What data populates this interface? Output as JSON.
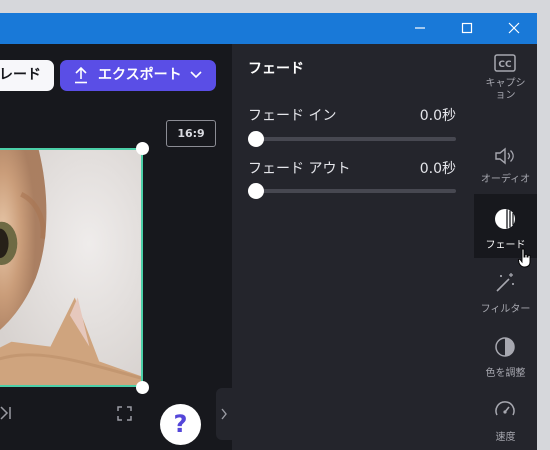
{
  "window": {
    "controls": {
      "minimize": "minimize-icon",
      "maximize": "maximize-icon",
      "close": "close-icon"
    },
    "accent": "#1979d8"
  },
  "toolbar": {
    "upgrade_label": "レード",
    "export_label": "エクスポート",
    "export_color": "#5a4ee6"
  },
  "canvas": {
    "aspect_ratio": "16:9",
    "frame_color": "#4ccfa8"
  },
  "help": {
    "label": "?"
  },
  "fade_panel": {
    "title": "フェード",
    "fade_in": {
      "label": "フェード イン",
      "value": "0.0秒",
      "level": 0
    },
    "fade_out": {
      "label": "フェード アウト",
      "value": "0.0秒",
      "level": 0
    }
  },
  "rail": {
    "items": [
      {
        "label": "キャプション",
        "icon": "cc-icon"
      },
      {
        "label": "オーディオ",
        "icon": "speaker-icon"
      },
      {
        "label": "フェード",
        "icon": "fade-icon",
        "active": true
      },
      {
        "label": "フィルター",
        "icon": "magic-wand-icon"
      },
      {
        "label": "色を調整",
        "icon": "contrast-icon"
      },
      {
        "label": "速度",
        "icon": "speedometer-icon"
      }
    ]
  }
}
